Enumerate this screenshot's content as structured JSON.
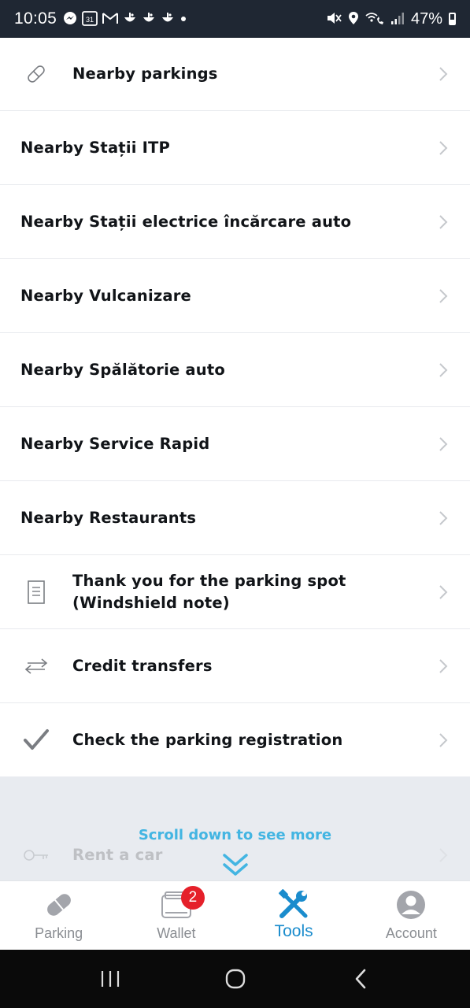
{
  "status_bar": {
    "time": "10:05",
    "left_icons": [
      "messenger-icon",
      "calendar-icon",
      "gmail-icon",
      "app-icon",
      "app-icon",
      "app-icon",
      "dot-icon"
    ],
    "calendar_day": "31",
    "battery": "47%"
  },
  "list": {
    "items": [
      {
        "label": "Nearby parkings",
        "icon": "parking-pill-icon"
      },
      {
        "label": "Nearby Stații ITP",
        "icon": ""
      },
      {
        "label": "Nearby Stații electrice încărcare auto",
        "icon": ""
      },
      {
        "label": "Nearby Vulcanizare",
        "icon": ""
      },
      {
        "label": "Nearby Spălătorie auto",
        "icon": ""
      },
      {
        "label": "Nearby Service Rapid",
        "icon": ""
      },
      {
        "label": "Nearby Restaurants",
        "icon": ""
      },
      {
        "label": "Thank you for the parking spot\n(Windshield note)",
        "icon": "document-icon"
      },
      {
        "label": "Credit transfers",
        "icon": "transfer-arrows-icon"
      },
      {
        "label": "Check the parking registration",
        "icon": "checkmark-icon"
      }
    ]
  },
  "faded": {
    "item_label": "Rent a car",
    "icon": "key-icon",
    "scroll_hint": "Scroll down to see more"
  },
  "bottom_nav": {
    "tabs": [
      {
        "label": "Parking",
        "icon": "parking-pill-icon",
        "active": false
      },
      {
        "label": "Wallet",
        "icon": "wallet-icon",
        "active": false,
        "badge": "2"
      },
      {
        "label": "Tools",
        "icon": "tools-icon",
        "active": true
      },
      {
        "label": "Account",
        "icon": "account-icon",
        "active": false
      }
    ]
  },
  "colors": {
    "accent": "#1a8ccd",
    "scroll_hint": "#43b5e2",
    "badge": "#e5202a",
    "status_bar": "#1f2733"
  }
}
